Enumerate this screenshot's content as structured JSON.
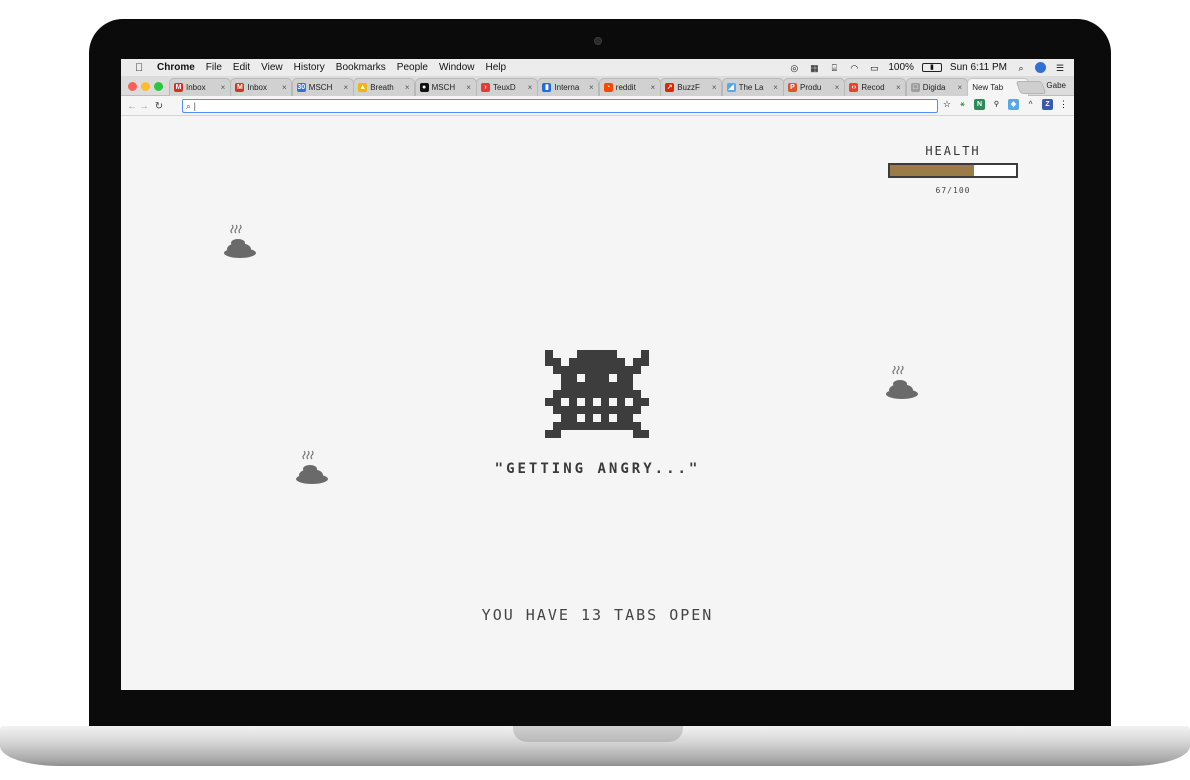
{
  "menubar": {
    "apple_icon": "apple-icon",
    "app_name": "Chrome",
    "items": [
      "File",
      "Edit",
      "View",
      "History",
      "Bookmarks",
      "People",
      "Window",
      "Help"
    ],
    "battery": "100%",
    "clock": "Sun 6:11 PM"
  },
  "tabs": [
    {
      "label": "Inbox",
      "favicon_color": "#d93025",
      "favicon_glyph": "M"
    },
    {
      "label": "Inbox",
      "favicon_color": "#d93025",
      "favicon_glyph": "M"
    },
    {
      "label": "MSCH",
      "favicon_color": "#2f6fd6",
      "favicon_glyph": "30"
    },
    {
      "label": "Breath",
      "favicon_color": "#f4b400",
      "favicon_glyph": "▲"
    },
    {
      "label": "MSCH",
      "favicon_color": "#111111",
      "favicon_glyph": "●"
    },
    {
      "label": "TeuxD",
      "favicon_color": "#e53935",
      "favicon_glyph": "›"
    },
    {
      "label": "Interna",
      "favicon_color": "#1e6fd9",
      "favicon_glyph": "▮"
    },
    {
      "label": "reddit",
      "favicon_color": "#ff4500",
      "favicon_glyph": "◔"
    },
    {
      "label": "BuzzF",
      "favicon_color": "#e32400",
      "favicon_glyph": "↗"
    },
    {
      "label": "The La",
      "favicon_color": "#5aa7e6",
      "favicon_glyph": "◢"
    },
    {
      "label": "Produ",
      "favicon_color": "#da552f",
      "favicon_glyph": "P"
    },
    {
      "label": "Recod",
      "favicon_color": "#e8412c",
      "favicon_glyph": "‹›"
    },
    {
      "label": "Digida",
      "favicon_color": "#9e9e9e",
      "favicon_glyph": "□"
    },
    {
      "label": "New Tab",
      "favicon_color": "",
      "favicon_glyph": ""
    }
  ],
  "profile_name": "Gabe",
  "omnibox": {
    "placeholder": "",
    "value": ""
  },
  "health": {
    "title": "HEALTH",
    "current": 67,
    "max": 100,
    "value_text": "67/100",
    "fill_color": "#9b7b46"
  },
  "monster_status": "\"GETTING ANGRY...\"",
  "tab_count_text": "YOU HAVE 13 TABS OPEN"
}
